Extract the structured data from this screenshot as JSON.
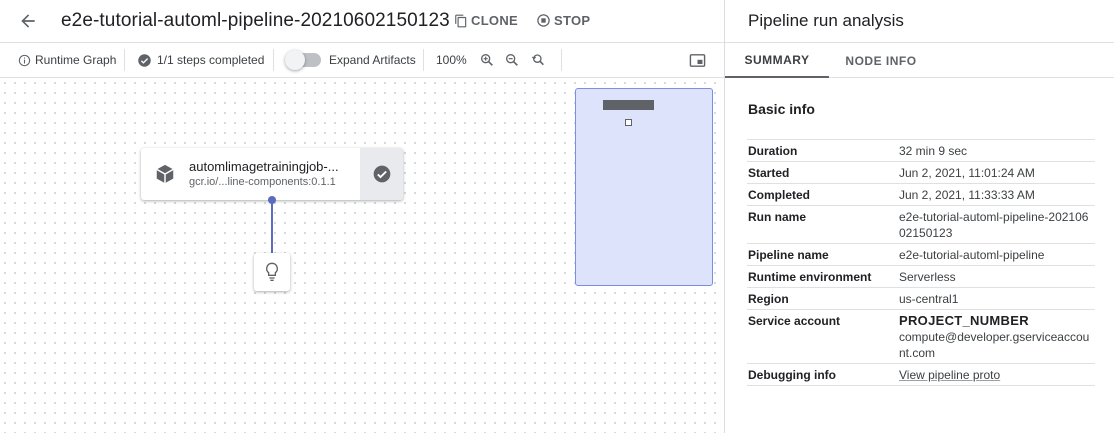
{
  "header": {
    "run_title": "e2e-tutorial-automl-pipeline-20210602150123",
    "clone_label": "CLONE",
    "stop_label": "STOP"
  },
  "toolbar": {
    "runtime_graph_label": "Runtime Graph",
    "steps_completed_label": "1/1 steps completed",
    "expand_artifacts_label": "Expand Artifacts",
    "expand_artifacts_on": false,
    "zoom_level": "100%"
  },
  "graph": {
    "node": {
      "name": "automlimagetrainingjob-...",
      "image": "gcr.io/...line-components:0.1.1",
      "status": "succeeded",
      "icon": "cube-icon",
      "status_icon": "check-circle-icon"
    },
    "artifact_icon": "lightbulb-icon"
  },
  "panel": {
    "title": "Pipeline run analysis",
    "tabs": [
      "SUMMARY",
      "NODE INFO"
    ],
    "active_tab": "SUMMARY",
    "section_title": "Basic info",
    "info": {
      "duration": {
        "label": "Duration",
        "value": "32 min 9 sec"
      },
      "started": {
        "label": "Started",
        "value": "Jun 2, 2021, 11:01:24 AM"
      },
      "completed": {
        "label": "Completed",
        "value": "Jun 2, 2021, 11:33:33 AM"
      },
      "run_name": {
        "label": "Run name",
        "value": "e2e-tutorial-automl-pipeline-20210602150123"
      },
      "pipeline_name": {
        "label": "Pipeline name",
        "value": "e2e-tutorial-automl-pipeline"
      },
      "runtime_env": {
        "label": "Runtime environment",
        "value": "Serverless"
      },
      "region": {
        "label": "Region",
        "value": "us-central1"
      },
      "service_account": {
        "label": "Service account",
        "value_project": "PROJECT_NUMBER",
        "value_domain": "compute@developer.gserviceaccount.com"
      },
      "debugging": {
        "label": "Debugging info",
        "value": "View pipeline proto"
      }
    }
  },
  "colors": {
    "accent": "#5c6bc0",
    "minimap_fill": "#dde3fb",
    "minimap_border": "#7b8fe0",
    "status_bg": "#e8eaed"
  }
}
